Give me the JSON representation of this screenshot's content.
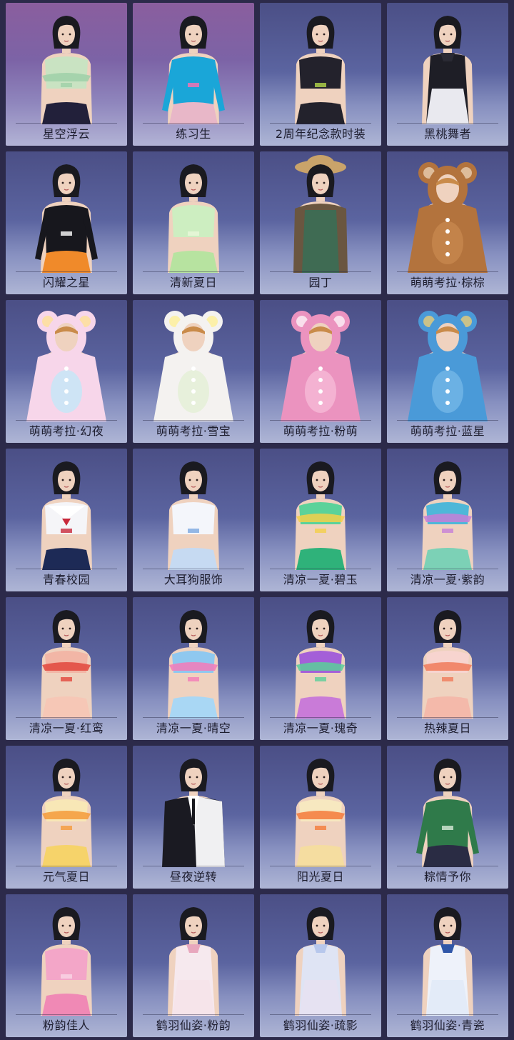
{
  "colors": {
    "background": "#2c2a4a",
    "card_text": "#1d1d2e",
    "card_sky_blue": "#5b64a0",
    "card_sky_purple": "#7c63a6",
    "hair": "#1a1a20",
    "skin": "#efd2bf"
  },
  "outfits": [
    {
      "name": "星空浮云",
      "sky": "purple",
      "style": "frill",
      "top": "#c9e3c2",
      "bottom": "#22203a",
      "accent": "#9fd0a8"
    },
    {
      "name": "练习生",
      "sky": "purple",
      "style": "sweater",
      "top": "#1aa6d8",
      "bottom": "#e8b7c8",
      "accent": "#ff6fb0"
    },
    {
      "name": "2周年纪念款时装",
      "sky": "blue",
      "style": "crop",
      "top": "#23222c",
      "bottom": "#23222c",
      "accent": "#b4d84a"
    },
    {
      "name": "黑桃舞者",
      "sky": "blue",
      "style": "dress",
      "top": "#1e1e26",
      "bottom": "#e9e9ef",
      "accent": "#2a2a34"
    },
    {
      "name": "闪耀之星",
      "sky": "blue",
      "style": "sport",
      "top": "#17171d",
      "bottom": "#f08a2a",
      "accent": "#ffffff"
    },
    {
      "name": "清新夏日",
      "sky": "blue",
      "style": "crop",
      "top": "#cdeec1",
      "bottom": "#b7e3a0",
      "accent": "#eaf7d9"
    },
    {
      "name": "园丁",
      "sky": "blue",
      "style": "gardener",
      "top": "#3f6b53",
      "bottom": "#6a5640",
      "accent": "#c9a36a"
    },
    {
      "name": "萌萌考拉·棕棕",
      "sky": "blue",
      "style": "koala",
      "top": "#b3733d",
      "bottom": "#c4854b",
      "accent": "#f1dcc2"
    },
    {
      "name": "萌萌考拉·幻夜",
      "sky": "blue",
      "style": "koala",
      "top": "#f7d6ea",
      "bottom": "#c9e6f6",
      "accent": "#ffe28a"
    },
    {
      "name": "萌萌考拉·雪宝",
      "sky": "blue",
      "style": "koala",
      "top": "#f4f2f0",
      "bottom": "#e6f0d8",
      "accent": "#fff08a"
    },
    {
      "name": "萌萌考拉·粉萌",
      "sky": "blue",
      "style": "koala",
      "top": "#eb93bf",
      "bottom": "#f5b6d4",
      "accent": "#ffffff"
    },
    {
      "name": "萌萌考拉·蓝星",
      "sky": "blue",
      "style": "koala",
      "top": "#4a9ad8",
      "bottom": "#6fb4e6",
      "accent": "#ffd36a"
    },
    {
      "name": "青春校园",
      "sky": "blue",
      "style": "sailor",
      "top": "#f5f5f8",
      "bottom": "#1d2a56",
      "accent": "#c8283a"
    },
    {
      "name": "大耳狗服饰",
      "sky": "blue",
      "style": "crop",
      "top": "#f4f6fb",
      "bottom": "#c6daf2",
      "accent": "#7aa7e0"
    },
    {
      "name": "清凉一夏·碧玉",
      "sky": "blue",
      "style": "bikini",
      "top": "#5bd29a",
      "bottom": "#2fb27a",
      "accent": "#f4d04a"
    },
    {
      "name": "清凉一夏·紫韵",
      "sky": "blue",
      "style": "bikini",
      "top": "#4fb7d8",
      "bottom": "#7cd1b6",
      "accent": "#c57fd8"
    },
    {
      "name": "清凉一夏·红鸾",
      "sky": "blue",
      "style": "bikini",
      "top": "#f2b6a6",
      "bottom": "#f6c7b6",
      "accent": "#e2463c"
    },
    {
      "name": "清凉一夏·晴空",
      "sky": "blue",
      "style": "bikini",
      "top": "#8fc8ef",
      "bottom": "#a9d7f4",
      "accent": "#f47ab8"
    },
    {
      "name": "清凉一夏·瑰奇",
      "sky": "blue",
      "style": "bikini",
      "top": "#a45fd8",
      "bottom": "#c97bd8",
      "accent": "#5bcf9a"
    },
    {
      "name": "热辣夏日",
      "sky": "blue",
      "style": "bikini",
      "top": "#f7d4cf",
      "bottom": "#f4b9aa",
      "accent": "#f07a5a"
    },
    {
      "name": "元气夏日",
      "sky": "blue",
      "style": "bikini",
      "top": "#f8e7b6",
      "bottom": "#f6d36a",
      "accent": "#f59a3a"
    },
    {
      "name": "昼夜逆转",
      "sky": "blue",
      "style": "suit",
      "top": "#f0f0f2",
      "bottom": "#1a1a22",
      "accent": "#18181e"
    },
    {
      "name": "阳光夏日",
      "sky": "blue",
      "style": "bikini",
      "top": "#f7e8c0",
      "bottom": "#f5dda0",
      "accent": "#f47a3a"
    },
    {
      "name": "粽情予你",
      "sky": "blue",
      "style": "jersey",
      "top": "#2f7a4a",
      "bottom": "#2a2c44",
      "accent": "#d8ead8"
    },
    {
      "name": "粉韵佳人",
      "sky": "blue",
      "style": "crop",
      "top": "#f3a6c8",
      "bottom": "#f089b5",
      "accent": "#f9d6e6"
    },
    {
      "name": "鹤羽仙姿·粉韵",
      "sky": "blue",
      "style": "qipao",
      "top": "#f6e9ee",
      "bottom": "#f6e4ea",
      "accent": "#e8a7bd"
    },
    {
      "name": "鹤羽仙姿·疏影",
      "sky": "blue",
      "style": "qipao",
      "top": "#dfe4f4",
      "bottom": "#e6e2f2",
      "accent": "#b7c7ec"
    },
    {
      "name": "鹤羽仙姿·青瓷",
      "sky": "blue",
      "style": "qipao",
      "top": "#eef2fa",
      "bottom": "#e3ebf8",
      "accent": "#2f56a8"
    }
  ]
}
